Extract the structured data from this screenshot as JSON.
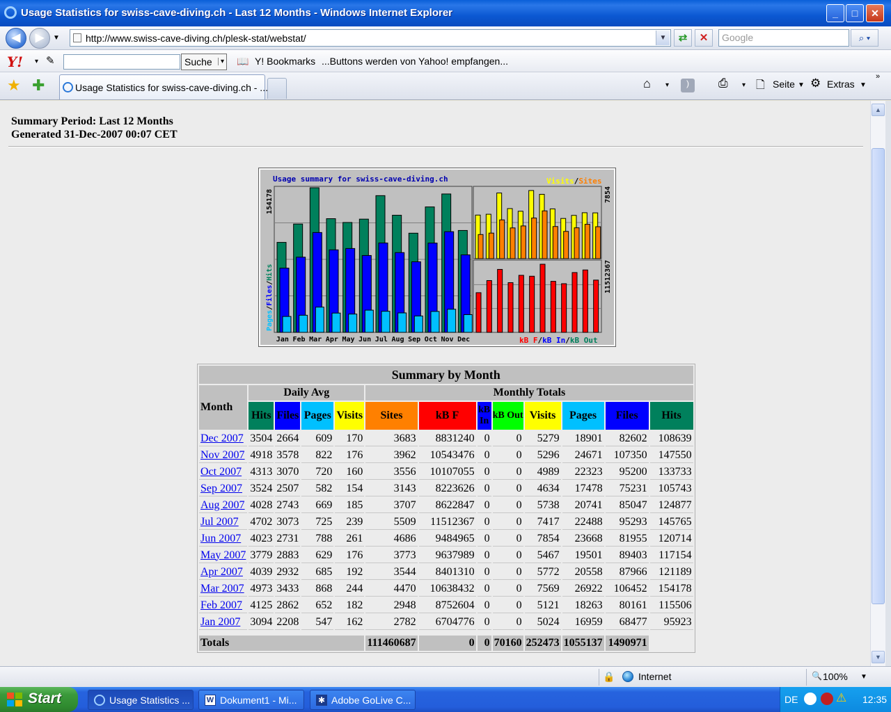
{
  "window": {
    "title": "Usage Statistics for swiss-cave-diving.ch - Last 12 Months - Windows Internet Explorer"
  },
  "address": {
    "url": "http://www.swiss-cave-diving.ch/plesk-stat/webstat/",
    "search_placeholder": "Google"
  },
  "yahoo": {
    "search_button": "Suche",
    "bookmarks": "Y! Bookmarks",
    "message": "...Buttons werden von Yahoo! empfangen..."
  },
  "tab": {
    "title": "Usage Statistics for swiss-cave-diving.ch - ..."
  },
  "commands": {
    "page": "Seite",
    "extras": "Extras"
  },
  "page": {
    "summary_period": "Summary Period: Last 12 Months",
    "generated": "Generated 31-Dec-2007 00:07 CET"
  },
  "chart_data": {
    "type": "bar",
    "title": "Usage summary for swiss-cave-diving.ch",
    "categories": [
      "Jan",
      "Feb",
      "Mar",
      "Apr",
      "May",
      "Jun",
      "Jul",
      "Aug",
      "Sep",
      "Oct",
      "Nov",
      "Dec"
    ],
    "left_axis_max": "154178",
    "top_right_axis_max": "7854",
    "bottom_right_axis_max": "11512367",
    "left_legend": [
      "Pages",
      "/",
      "Files",
      "/",
      "Hits"
    ],
    "top_legend": [
      "Visits",
      "/",
      "Sites"
    ],
    "bottom_legend": [
      "kB F",
      "/",
      "kB In",
      "/",
      "kB Out"
    ],
    "colors": {
      "hits": "#00805c",
      "files": "#0000ff",
      "pages": "#00c0ff",
      "visits": "#ffff00",
      "sites": "#ff8000",
      "kbf": "#ff0000",
      "kbin": "#0000ff",
      "kbout": "#00805c"
    },
    "series": [
      {
        "name": "Hits",
        "values": [
          95923,
          115506,
          154178,
          121189,
          117154,
          120714,
          145765,
          124877,
          105743,
          133733,
          147550,
          108639
        ]
      },
      {
        "name": "Files",
        "values": [
          68477,
          80161,
          106452,
          87966,
          89403,
          81955,
          95293,
          85047,
          75231,
          95200,
          107350,
          82602
        ]
      },
      {
        "name": "Pages",
        "values": [
          16959,
          18263,
          26922,
          20558,
          19501,
          23668,
          22488,
          20741,
          17478,
          22323,
          24671,
          18901
        ]
      },
      {
        "name": "Visits",
        "values": [
          5024,
          5121,
          7569,
          5772,
          5467,
          7854,
          7417,
          5738,
          4634,
          4989,
          5296,
          5279
        ]
      },
      {
        "name": "Sites",
        "values": [
          2782,
          2948,
          4470,
          3544,
          3773,
          4686,
          5509,
          3707,
          3143,
          3556,
          3962,
          3683
        ]
      },
      {
        "name": "kB F",
        "values": [
          6704776,
          8752604,
          10638432,
          8401310,
          9637989,
          9484965,
          11512367,
          8622847,
          8223626,
          10107055,
          10543476,
          8831240
        ]
      }
    ]
  },
  "table": {
    "caption": "Summary by Month",
    "month_header": "Month",
    "daily_avg": "Daily Avg",
    "monthly_totals": "Monthly Totals",
    "cols": [
      "Hits",
      "Files",
      "Pages",
      "Visits",
      "Sites",
      "kB F",
      "kB In",
      "kB Out",
      "Visits",
      "Pages",
      "Files",
      "Hits"
    ],
    "rows": [
      [
        "Dec 2007",
        "3504",
        "2664",
        "609",
        "170",
        "3683",
        "8831240",
        "0",
        "0",
        "5279",
        "18901",
        "82602",
        "108639"
      ],
      [
        "Nov 2007",
        "4918",
        "3578",
        "822",
        "176",
        "3962",
        "10543476",
        "0",
        "0",
        "5296",
        "24671",
        "107350",
        "147550"
      ],
      [
        "Oct 2007",
        "4313",
        "3070",
        "720",
        "160",
        "3556",
        "10107055",
        "0",
        "0",
        "4989",
        "22323",
        "95200",
        "133733"
      ],
      [
        "Sep 2007",
        "3524",
        "2507",
        "582",
        "154",
        "3143",
        "8223626",
        "0",
        "0",
        "4634",
        "17478",
        "75231",
        "105743"
      ],
      [
        "Aug 2007",
        "4028",
        "2743",
        "669",
        "185",
        "3707",
        "8622847",
        "0",
        "0",
        "5738",
        "20741",
        "85047",
        "124877"
      ],
      [
        "Jul 2007",
        "4702",
        "3073",
        "725",
        "239",
        "5509",
        "11512367",
        "0",
        "0",
        "7417",
        "22488",
        "95293",
        "145765"
      ],
      [
        "Jun 2007",
        "4023",
        "2731",
        "788",
        "261",
        "4686",
        "9484965",
        "0",
        "0",
        "7854",
        "23668",
        "81955",
        "120714"
      ],
      [
        "May 2007",
        "3779",
        "2883",
        "629",
        "176",
        "3773",
        "9637989",
        "0",
        "0",
        "5467",
        "19501",
        "89403",
        "117154"
      ],
      [
        "Apr 2007",
        "4039",
        "2932",
        "685",
        "192",
        "3544",
        "8401310",
        "0",
        "0",
        "5772",
        "20558",
        "87966",
        "121189"
      ],
      [
        "Mar 2007",
        "4973",
        "3433",
        "868",
        "244",
        "4470",
        "10638432",
        "0",
        "0",
        "7569",
        "26922",
        "106452",
        "154178"
      ],
      [
        "Feb 2007",
        "4125",
        "2862",
        "652",
        "182",
        "2948",
        "8752604",
        "0",
        "0",
        "5121",
        "18263",
        "80161",
        "115506"
      ],
      [
        "Jan 2007",
        "3094",
        "2208",
        "547",
        "162",
        "2782",
        "6704776",
        "0",
        "0",
        "5024",
        "16959",
        "68477",
        "95923"
      ]
    ],
    "totals_label": "Totals",
    "totals": [
      "111460687",
      "0",
      "0",
      "70160",
      "252473",
      "1055137",
      "1490971"
    ]
  },
  "status": {
    "zone": "Internet",
    "zoom": "100%"
  },
  "taskbar": {
    "start": "Start",
    "tasks": [
      "Usage Statistics ...",
      "Dokument1 - Mi...",
      "Adobe GoLive C..."
    ],
    "lang": "DE",
    "clock": "12:35"
  }
}
